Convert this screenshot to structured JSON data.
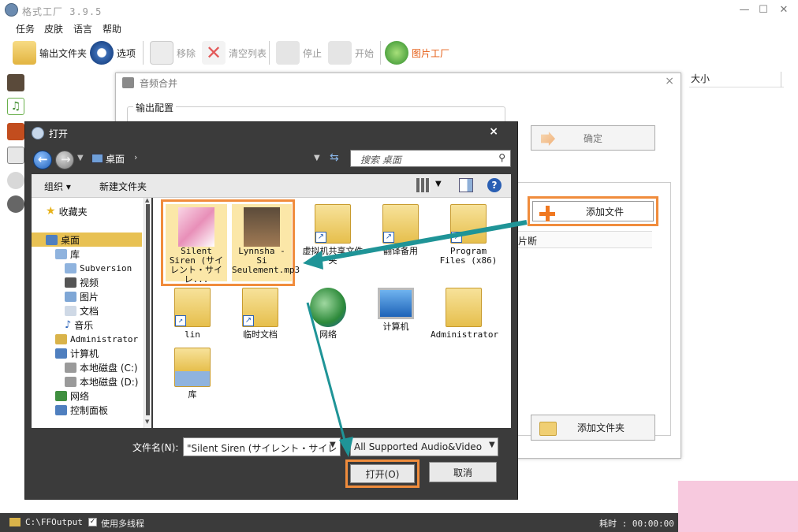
{
  "app": {
    "title": "格式工厂 3.9.5",
    "controls": {
      "minimize": "—",
      "maximize": "☐",
      "close": "✕"
    }
  },
  "menu": [
    "任务",
    "皮肤",
    "语言",
    "帮助"
  ],
  "toolbar": {
    "output_folder": "输出文件夹",
    "options": "选项",
    "remove": "移除",
    "clear_list": "清空列表",
    "stop": "停止",
    "start": "开始",
    "picture_factory": "图片工厂"
  },
  "task_list": {
    "size_header": "大小"
  },
  "merge_dialog": {
    "title": "音频合并",
    "close": "×",
    "output_config": "输出配置",
    "ok": "确定",
    "add_file": "添加文件",
    "clip_col": "片断",
    "add_folder": "添加文件夹"
  },
  "open_dialog": {
    "title": "打开",
    "close": "×",
    "address": "桌面",
    "address_chevron": "›",
    "search_placeholder": "搜索 桌面",
    "organize": "组织",
    "new_folder": "新建文件夹",
    "nav": [
      {
        "label": "收藏夹",
        "indent": 0
      },
      {
        "label": "桌面",
        "indent": 0
      },
      {
        "label": "库",
        "indent": 1
      },
      {
        "label": "Subversion",
        "indent": 2
      },
      {
        "label": "视频",
        "indent": 2
      },
      {
        "label": "图片",
        "indent": 2
      },
      {
        "label": "文档",
        "indent": 2
      },
      {
        "label": "音乐",
        "indent": 2
      },
      {
        "label": "Administrator",
        "indent": 1
      },
      {
        "label": "计算机",
        "indent": 1
      },
      {
        "label": "本地磁盘 (C:)",
        "indent": 2
      },
      {
        "label": "本地磁盘 (D:)",
        "indent": 2
      },
      {
        "label": "网络",
        "indent": 1
      },
      {
        "label": "控制面板",
        "indent": 1
      }
    ],
    "files": [
      {
        "name": "Silent Siren (サイレント・サイレ...",
        "kind": "audio"
      },
      {
        "name": "Lynnsha - Si Seulement.mp3",
        "kind": "audio"
      },
      {
        "name": "虚拟机共享文件夹",
        "kind": "shortcut"
      },
      {
        "name": "翻译备用",
        "kind": "shortcut"
      },
      {
        "name": "Program Files (x86)",
        "kind": "shortcut"
      },
      {
        "name": "lin",
        "kind": "shortcut"
      },
      {
        "name": "临时文档",
        "kind": "shortcut"
      },
      {
        "name": "网络",
        "kind": "network"
      },
      {
        "name": "计算机",
        "kind": "computer"
      },
      {
        "name": "Administrator",
        "kind": "user"
      },
      {
        "name": "库",
        "kind": "library"
      }
    ],
    "filename_label": "文件名(N):",
    "filename_value": "\"Silent Siren (サイレント・サイレ",
    "filetype": "All Supported Audio&Video",
    "open_btn": "打开(O)",
    "cancel_btn": "取消"
  },
  "statusbar": {
    "path": "C:\\FFOutput",
    "multithread": "使用多线程",
    "elapsed": "耗时 : 00:00:00"
  },
  "colors": {
    "highlight": "#f08c3c",
    "arrow": "#1f9497",
    "dialog_frame": "#3b3b3b"
  }
}
